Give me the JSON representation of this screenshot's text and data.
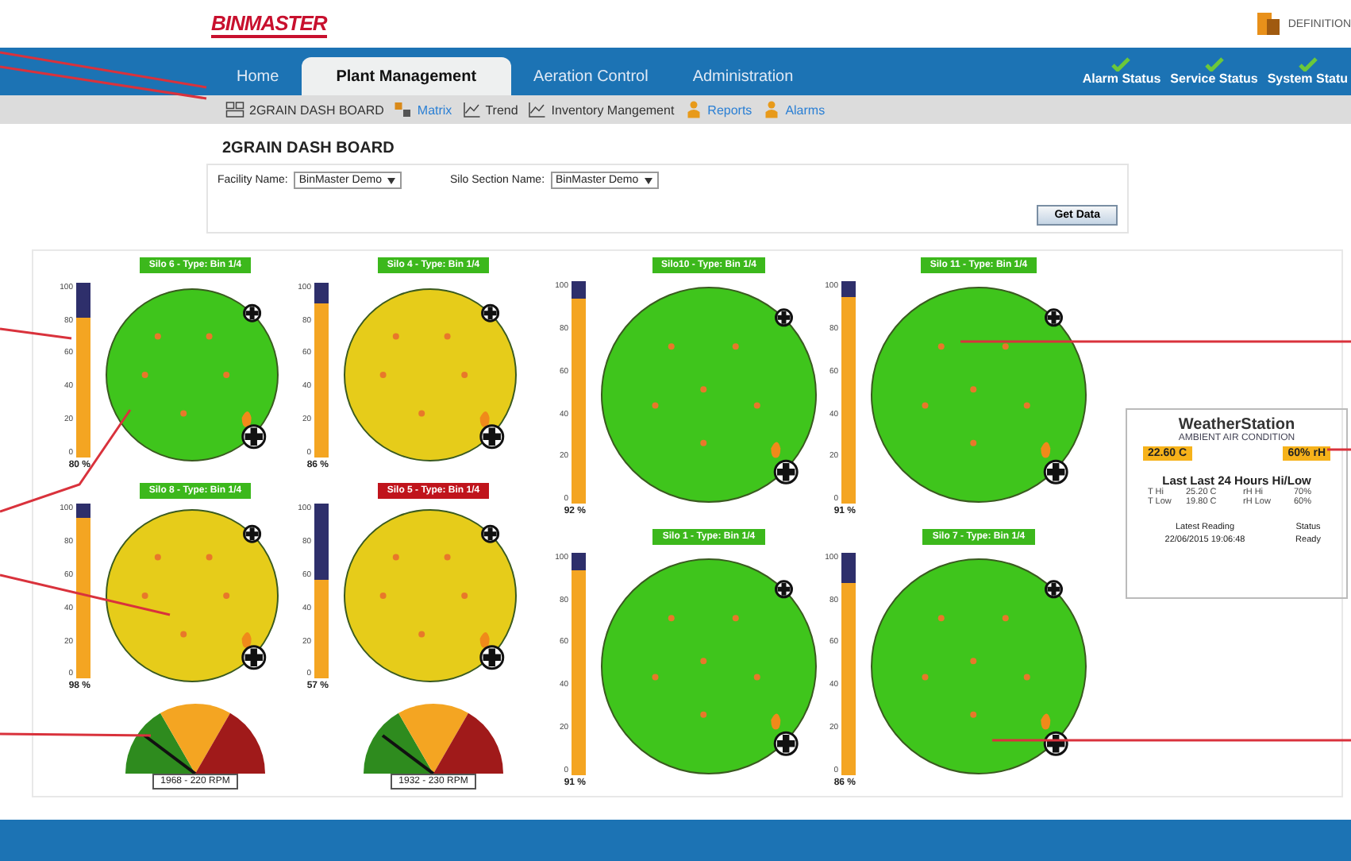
{
  "header": {
    "logo": "BINMASTER",
    "brand_text": "DEFINITION"
  },
  "nav": {
    "tabs": [
      {
        "label": "Home",
        "selected": false
      },
      {
        "label": "Plant Management",
        "selected": true
      },
      {
        "label": "Aeration Control",
        "selected": false
      },
      {
        "label": "Administration",
        "selected": false
      }
    ],
    "status": [
      {
        "label": "Alarm Status",
        "ok": true
      },
      {
        "label": "Service Status",
        "ok": true
      },
      {
        "label": "System Statu",
        "ok": true
      }
    ]
  },
  "subnav": [
    {
      "label": "2GRAIN DASH BOARD",
      "kind": "dashboard",
      "active": false
    },
    {
      "label": "Matrix",
      "kind": "matrix",
      "active": true
    },
    {
      "label": "Trend",
      "kind": "trend",
      "active": false
    },
    {
      "label": "Inventory Mangement",
      "kind": "trend",
      "active": false
    },
    {
      "label": "Reports",
      "kind": "person",
      "active": true
    },
    {
      "label": "Alarms",
      "kind": "person",
      "active": true
    }
  ],
  "page_title": "2GRAIN DASH BOARD",
  "filters": {
    "facility_label": "Facility Name:",
    "facility_value": "BinMaster Demo",
    "section_label": "Silo Section Name:",
    "section_value": "BinMaster Demo",
    "button": "Get Data"
  },
  "small_silos": [
    {
      "label": "Silo 6 - Type: Bin 1/4",
      "alert": false,
      "color": "#3fc51c",
      "level": 0.8,
      "reading": "80 %",
      "scale": [
        "100",
        "80",
        "60",
        "40",
        "20",
        "0"
      ]
    },
    {
      "label": "Silo 4 - Type: Bin 1/4",
      "alert": false,
      "color": "#e6cc1a",
      "level": 0.88,
      "reading": "86 %",
      "scale": [
        "100",
        "80",
        "60",
        "40",
        "20",
        "0"
      ]
    },
    {
      "label": "Silo 8 - Type: Bin 1/4",
      "alert": false,
      "color": "#e6cc1a",
      "level": 0.92,
      "reading": "98 %",
      "scale": [
        "100",
        "80",
        "60",
        "40",
        "20",
        "0"
      ],
      "gauge": {
        "reading": "1968 - 220 RPM"
      }
    },
    {
      "label": "Silo 5 - Type: Bin 1/4",
      "alert": true,
      "color": "#e6cc1a",
      "level": 0.57,
      "reading": "57 %",
      "scale": [
        "100",
        "80",
        "60",
        "40",
        "20",
        "0"
      ],
      "gauge": {
        "reading": "1932 - 230 RPM"
      }
    }
  ],
  "large_silos": [
    {
      "label": "Silo10 - Type: Bin 1/4",
      "alert": false,
      "color": "#3fc51c",
      "level": 0.92,
      "reading": "92 %",
      "scale": [
        "100",
        "80",
        "60",
        "40",
        "20",
        "0"
      ]
    },
    {
      "label": "Silo 11 - Type: Bin 1/4",
      "alert": false,
      "color": "#3fc51c",
      "level": 0.93,
      "reading": "91 %",
      "scale": [
        "100",
        "80",
        "60",
        "40",
        "20",
        "0"
      ]
    },
    {
      "label": "Silo 1 - Type: Bin 1/4",
      "alert": false,
      "color": "#3fc51c",
      "level": 0.92,
      "reading": "91 %",
      "scale": [
        "100",
        "80",
        "60",
        "40",
        "20",
        "0"
      ]
    },
    {
      "label": "Silo 7 - Type: Bin 1/4",
      "alert": false,
      "color": "#3fc51c",
      "level": 0.86,
      "reading": "86 %",
      "scale": [
        "100",
        "80",
        "60",
        "40",
        "20",
        "0"
      ]
    }
  ],
  "weather": {
    "title": "WeatherStation",
    "subtitle": "AMBIENT AIR CONDITION",
    "temperature": "22.60 C",
    "humidity": "60% rH",
    "range_title": "Last Last 24 Hours Hi/Low",
    "rows": [
      [
        "T Hi",
        "25.20 C",
        "rH Hi",
        "70%"
      ],
      [
        "T Low",
        "19.80 C",
        "rH Low",
        "60%"
      ]
    ],
    "latest_label": "Latest Reading",
    "latest_value": "22/06/2015 19:06:48",
    "status_label": "Status",
    "status_value": "Ready"
  }
}
